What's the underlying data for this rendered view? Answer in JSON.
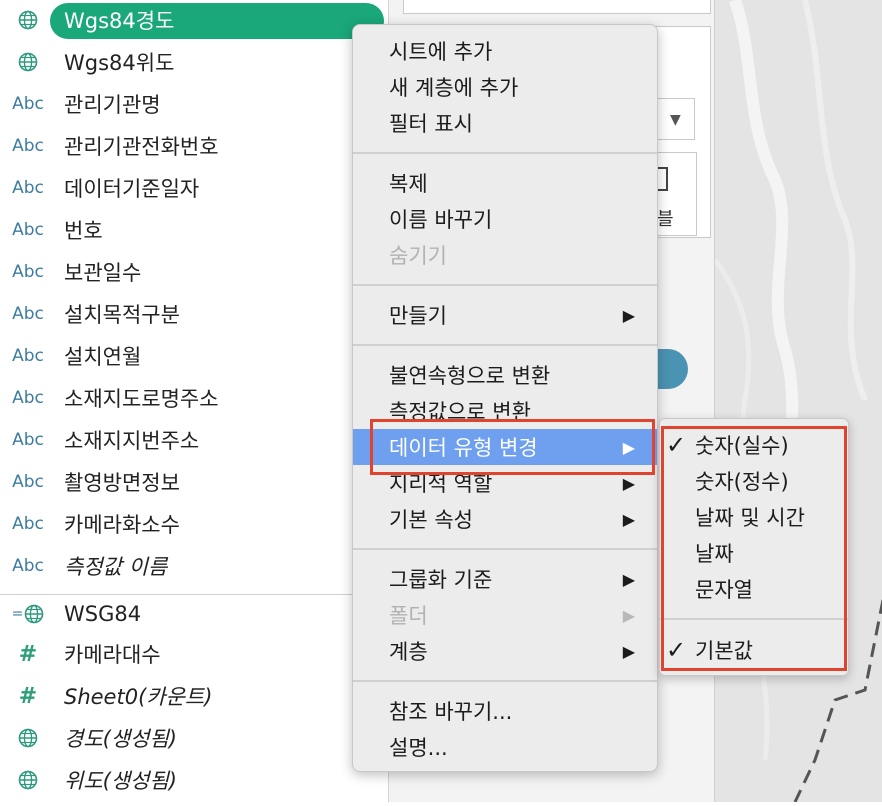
{
  "fields": [
    {
      "icon": "globe-icon",
      "name": "Wgs84경도",
      "selected": true
    },
    {
      "icon": "globe-icon",
      "name": "Wgs84위도"
    },
    {
      "icon": "abc-icon",
      "icon_text": "Abc",
      "name": "관리기관명"
    },
    {
      "icon": "abc-icon",
      "icon_text": "Abc",
      "name": "관리기관전화번호"
    },
    {
      "icon": "abc-icon",
      "icon_text": "Abc",
      "name": "데이터기준일자"
    },
    {
      "icon": "abc-icon",
      "icon_text": "Abc",
      "name": "번호"
    },
    {
      "icon": "abc-icon",
      "icon_text": "Abc",
      "name": "보관일수"
    },
    {
      "icon": "abc-icon",
      "icon_text": "Abc",
      "name": "설치목적구분"
    },
    {
      "icon": "abc-icon",
      "icon_text": "Abc",
      "name": "설치연월"
    },
    {
      "icon": "abc-icon",
      "icon_text": "Abc",
      "name": "소재지도로명주소"
    },
    {
      "icon": "abc-icon",
      "icon_text": "Abc",
      "name": "소재지지번주소"
    },
    {
      "icon": "abc-icon",
      "icon_text": "Abc",
      "name": "촬영방면정보"
    },
    {
      "icon": "abc-icon",
      "icon_text": "Abc",
      "name": "카메라화소수"
    },
    {
      "icon": "abc-icon",
      "icon_text": "Abc",
      "name": "측정값 이름",
      "italic": true
    },
    {
      "icon": "linked-globe-icon",
      "name": "WSG84"
    },
    {
      "icon": "hash-icon",
      "icon_text": "#",
      "name": "카메라대수"
    },
    {
      "icon": "hash-icon",
      "icon_text": "#",
      "name": "Sheet0(카운트)",
      "italic": true
    },
    {
      "icon": "globe-icon",
      "name": "경도(생성됨)",
      "italic": true
    },
    {
      "icon": "globe-icon",
      "name": "위도(생성됨)",
      "italic": true
    }
  ],
  "mid_panel": {
    "partial_text": "블"
  },
  "context_menu": {
    "groups": [
      [
        {
          "label": "시트에 추가"
        },
        {
          "label": "새 계층에 추가"
        },
        {
          "label": "필터 표시"
        }
      ],
      [
        {
          "label": "복제"
        },
        {
          "label": "이름 바꾸기"
        },
        {
          "label": "숨기기",
          "disabled": true
        }
      ],
      [
        {
          "label": "만들기",
          "submenu": true
        }
      ],
      [
        {
          "label": "불연속형으로 변환"
        },
        {
          "label": "측정값으로 변환"
        },
        {
          "label": "데이터 유형 변경",
          "submenu": true,
          "highlighted": true
        },
        {
          "label": "지리적 역할",
          "submenu": true
        },
        {
          "label": "기본 속성",
          "submenu": true
        }
      ],
      [
        {
          "label": "그룹화 기준",
          "submenu": true
        },
        {
          "label": "폴더",
          "submenu": true,
          "disabled": true
        },
        {
          "label": "계층",
          "submenu": true
        }
      ],
      [
        {
          "label": "참조 바꾸기..."
        },
        {
          "label": "설명..."
        }
      ]
    ],
    "arrow_glyph": "▶"
  },
  "data_type_submenu": {
    "items": [
      {
        "label": "숫자(실수)",
        "checked": true
      },
      {
        "label": "숫자(정수)"
      },
      {
        "label": "날짜 및 시간"
      },
      {
        "label": "날짜"
      },
      {
        "label": "문자열"
      }
    ],
    "default_item": {
      "label": "기본값",
      "checked": true
    },
    "check_glyph": "✓"
  },
  "colors": {
    "selected_pill": "#1aa77a",
    "menu_highlight": "#6f9fef",
    "annotation_red": "#e0442f"
  }
}
